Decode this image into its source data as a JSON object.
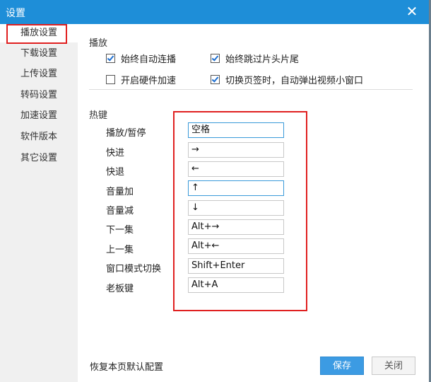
{
  "window": {
    "title": "设置",
    "close_icon": "close-icon"
  },
  "sidebar": {
    "items": [
      {
        "label": "播放设置",
        "active": true
      },
      {
        "label": "下载设置"
      },
      {
        "label": "上传设置"
      },
      {
        "label": "转码设置"
      },
      {
        "label": "加速设置"
      },
      {
        "label": "软件版本"
      },
      {
        "label": "其它设置"
      }
    ]
  },
  "playback": {
    "title": "播放",
    "options": [
      {
        "label": "始终自动连播",
        "checked": true
      },
      {
        "label": "始终跳过片头片尾",
        "checked": true
      },
      {
        "label": "开启硬件加速",
        "checked": false
      },
      {
        "label": "切换页签时，自动弹出视频小窗口",
        "checked": true
      }
    ]
  },
  "hotkeys": {
    "title": "热键",
    "rows": [
      {
        "label": "播放/暂停",
        "value": "空格",
        "focused": true
      },
      {
        "label": "快进",
        "value": "→"
      },
      {
        "label": "快退",
        "value": "←"
      },
      {
        "label": "音量加",
        "value": "↑",
        "focused": true
      },
      {
        "label": "音量减",
        "value": "↓"
      },
      {
        "label": "下一集",
        "value": "Alt+→"
      },
      {
        "label": "上一集",
        "value": "Alt+←"
      },
      {
        "label": "窗口模式切换",
        "value": "Shift+Enter"
      },
      {
        "label": "老板键",
        "value": "Alt+A"
      }
    ]
  },
  "footer": {
    "reset_label": "恢复本页默认配置",
    "save_label": "保存",
    "close_label": "关闭"
  },
  "colors": {
    "titlebar": "#1e8ed8",
    "accent_button": "#3c9be3",
    "highlight": "#e02020"
  }
}
